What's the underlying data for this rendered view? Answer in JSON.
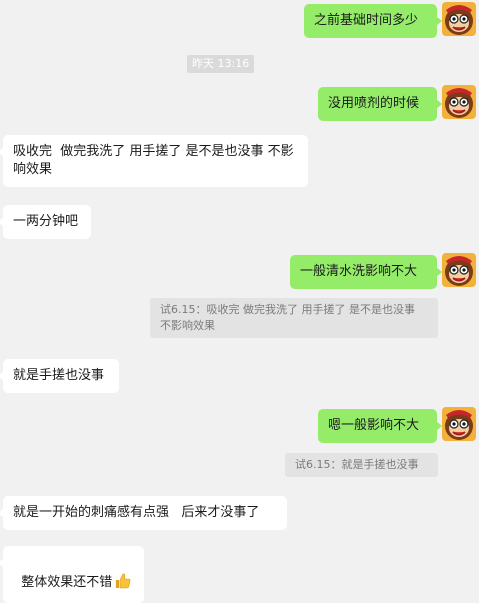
{
  "messages": [
    {
      "text": "之前基础时间多少",
      "side": "out"
    },
    {
      "text": "昨天 13:16",
      "type": "timestamp"
    },
    {
      "text": "没用喷剂的时候",
      "side": "out"
    },
    {
      "text": "吸收完  做完我洗了 用手搓了 是不是也没事 不影响效果",
      "side": "in"
    },
    {
      "text": "一两分钟吧",
      "side": "in"
    },
    {
      "text": "一般清水洗影响不大",
      "side": "out"
    },
    {
      "text": "试6.15：吸收完  做完我洗了 用手搓了 是不是也没事 不影响效果",
      "type": "quote"
    },
    {
      "text": "就是手搓也没事",
      "side": "in"
    },
    {
      "text": "嗯一般影响不大",
      "side": "out"
    },
    {
      "text": "试6.15：就是手搓也没事",
      "type": "quote"
    },
    {
      "text": "就是一开始的刺痛感有点强   后来才没事了",
      "side": "in"
    },
    {
      "text": "整体效果还不错",
      "side": "in",
      "emoji": "thumbs-up-icon"
    }
  ],
  "colors": {
    "outgoing_bubble": "#95ec69",
    "incoming_bubble": "#ffffff",
    "background": "#f1f1f1",
    "quote_bg": "#e3e3e3",
    "timestamp_bg": "#dadada"
  }
}
